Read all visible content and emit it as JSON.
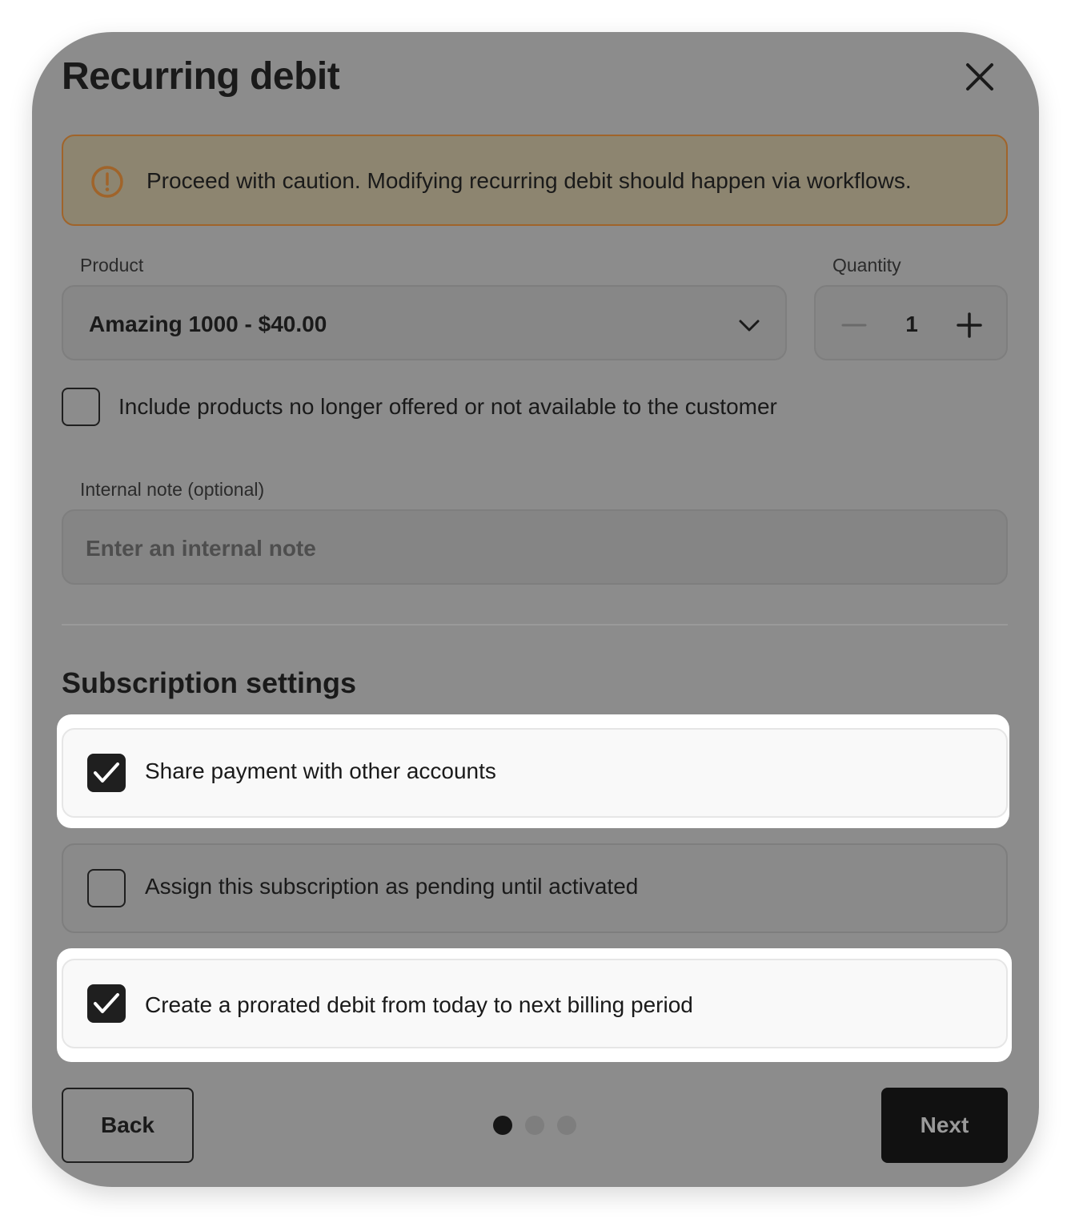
{
  "dialog": {
    "title": "Recurring debit"
  },
  "warning": {
    "text": "Proceed with caution. Modifying recurring debit should happen via workflows."
  },
  "product": {
    "label": "Product",
    "selected": "Amazing 1000 - $40.00"
  },
  "quantity": {
    "label": "Quantity",
    "value": "1"
  },
  "include_unavailable": {
    "label": "Include products no longer offered or not available to the customer",
    "checked": false
  },
  "internal_note": {
    "label": "Internal note (optional)",
    "placeholder": "Enter an internal note",
    "value": ""
  },
  "subscription_settings": {
    "title": "Subscription settings",
    "options": [
      {
        "label": "Share payment with other accounts",
        "checked": true
      },
      {
        "label": "Assign this subscription as pending until activated",
        "checked": false
      },
      {
        "label": "Create a prorated debit from today to next billing period",
        "checked": true
      }
    ]
  },
  "footer": {
    "back_label": "Back",
    "next_label": "Next",
    "steps_total": 3,
    "current_step": 1
  },
  "colors": {
    "warning_border": "#a0642a",
    "warning_icon": "#a0642a",
    "primary": "#111111"
  }
}
